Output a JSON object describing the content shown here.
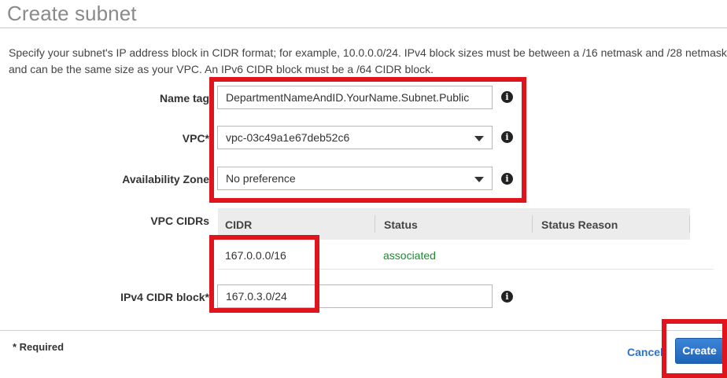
{
  "page": {
    "title": "Create subnet",
    "description_line1": "Specify your subnet's IP address block in CIDR format; for example, 10.0.0.0/24. IPv4 block sizes must be between a /16 netmask and /28 netmask",
    "description_line2": "and can be the same size as your VPC. An IPv6 CIDR block must be a /64 CIDR block."
  },
  "form": {
    "name_tag": {
      "label": "Name tag",
      "value": "DepartmentNameAndID.YourName.Subnet.Public"
    },
    "vpc": {
      "label": "VPC*",
      "value": "vpc-03c49a1e67deb52c6"
    },
    "availability_zone": {
      "label": "Availability Zone",
      "value": "No preference"
    },
    "vpc_cidrs": {
      "label": "VPC CIDRs",
      "columns": [
        "CIDR",
        "Status",
        "Status Reason"
      ],
      "rows": [
        {
          "cidr": "167.0.0.0/16",
          "status": "associated",
          "reason": ""
        }
      ]
    },
    "ipv4_cidr": {
      "label": "IPv4 CIDR block*",
      "value": "167.0.3.0/24"
    }
  },
  "footer": {
    "required_note": "* Required",
    "cancel_label": "Cancel",
    "create_label": "Create"
  },
  "icons": {
    "info": "info-icon",
    "dropdown": "caret-down-icon"
  },
  "colors": {
    "highlight": "#e0141c",
    "status_associated": "#1d8a2f",
    "link": "#2e72c4",
    "primary_button": "#1e63b8"
  }
}
